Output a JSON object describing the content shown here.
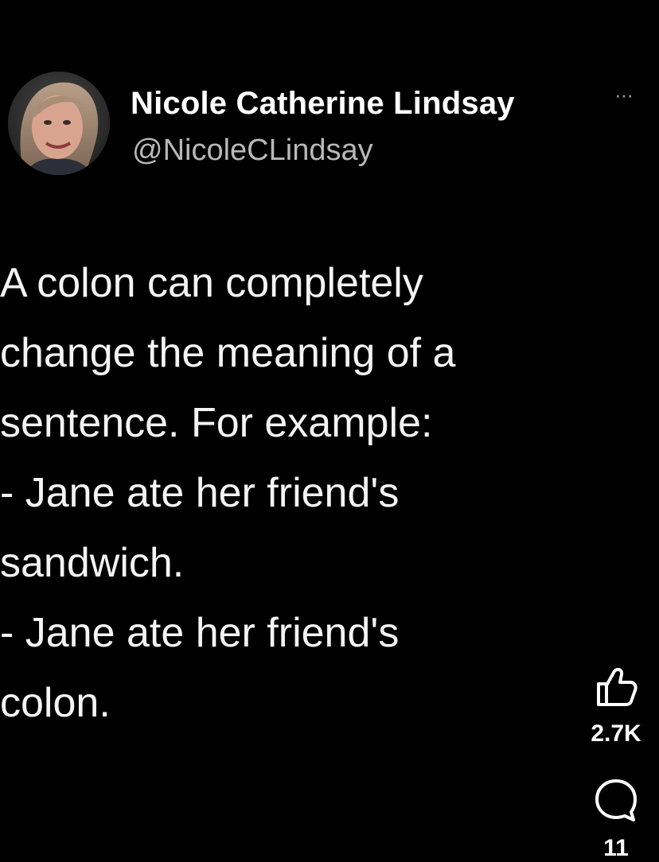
{
  "post": {
    "author_name": "Nicole Catherine Lindsay",
    "more_label": "···",
    "handle": "@NicoleCLindsay",
    "lines": [
      "A colon can completely",
      "change the meaning of a",
      "sentence. For example:",
      "- Jane ate her friend's",
      "sandwich.",
      "- Jane ate her friend's",
      "colon."
    ]
  },
  "actions": {
    "like_icon": "thumbs-up-icon",
    "like_count": "2.7K",
    "comment_icon": "comment-icon",
    "comment_count": "11"
  },
  "colors": {
    "background": "#000000",
    "text": "#f4f4f4",
    "handle": "#b8b8b8"
  }
}
